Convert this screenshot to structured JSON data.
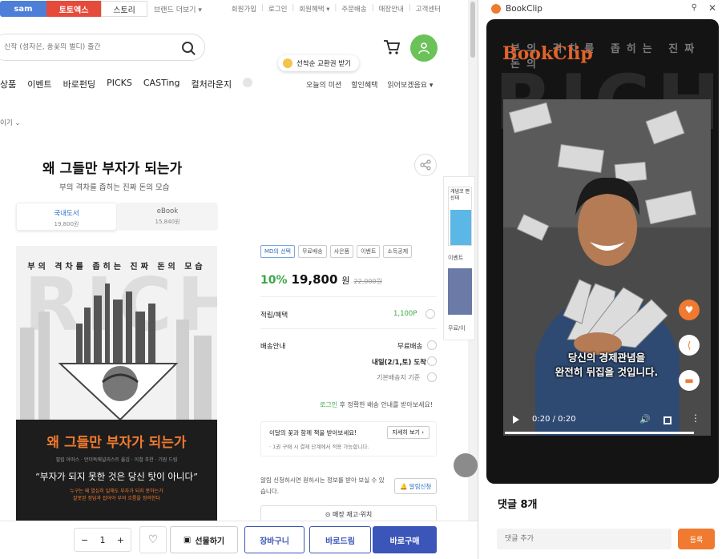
{
  "shop": {
    "top_tabs": [
      "sam",
      "토토엑스",
      "스토리"
    ],
    "brand_more": "브랜드 더보기 ▾",
    "util_links": [
      "회원가입",
      "로그인",
      "회원혜택 ▾",
      "주문배송",
      "매장안내",
      "고객센터"
    ],
    "search": {
      "placeholder": "신작 (성자은, 풍꽃의 벌디) 출간"
    },
    "coin_badge": "선착순 교환권 받기",
    "gnb": [
      "상품",
      "이벤트",
      "바로펀딩",
      "PICKS",
      "CASTing",
      "컬처라운지"
    ],
    "gnb_right": [
      "오늘의 미션",
      "할인혜택",
      "읽어보겠음요 ▾"
    ],
    "breadcrumb": "이기 ⌄",
    "book": {
      "title": "왜 그들만 부자가 되는가",
      "subtitle": "부의 격차를 좁히는 진짜 돈의 모습",
      "format_print": "국내도서",
      "format_print_price": "19,800원",
      "format_ebook": "eBook",
      "format_ebook_price": "15,840원"
    },
    "cover": {
      "top_text": "부의 격차를 좁히는 진짜 돈의 모습",
      "rich": "RICH",
      "title": "왜 그들만 부자가 되는가",
      "small": "필립 아마스 · 언더독애널리스트 옮김 · 이철 추천 · 기원 드림",
      "quote": "“부자가 되지 못한 것은 당신 탓이 아니다”",
      "line1": "누구는 왜 열심히 일해도 부자가 되지 못하는가",
      "line2": "잘못된 정답과 잡아야 부의 흐름을 정의한다"
    },
    "tags": [
      "MD의 선택",
      "무료배송",
      "사은품",
      "이벤트",
      "소득공제"
    ],
    "price": {
      "discount": "10%",
      "now": "19,800",
      "won": "원",
      "original": "22,000원"
    },
    "points_label": "적립/혜택",
    "points_value": "1,100P",
    "delivery_label": "배송안내",
    "delivery_free": "무료배송",
    "delivery_date": "내일(2/1,토) 도착",
    "delivery_base": "기본배송지 기준",
    "login_note_link": "로그인",
    "login_note_rest": " 후 정확한 배송 안내를 받아보세요!",
    "promo_text1": "이달의 꽃과 함께 책을 받아보세요!",
    "promo_text2": "· 1권 구매 시 결제 단계에서 적용 가능합니다.",
    "promo_btn": "자세히 보기 ›",
    "alarm_text": "알림 신청하시면 원하시는 정보를 받아 보실 수 있습니다.",
    "alarm_btn": "🔔 알림신청",
    "stock_btn": "⊙ 매장 재고·위치",
    "rail_thumb_text": "개념코 편 신데",
    "rail_label1": "이벤트",
    "rail_label2": "무료/이",
    "buybar": {
      "qty": "1",
      "minus": "−",
      "plus": "+",
      "gift": "선물하기",
      "cart": "장바구니",
      "drim": "바로드림",
      "buy": "바로구매"
    }
  },
  "bookclip": {
    "window_title": "BookClip",
    "brand": "BookClip",
    "watermark_text": "부의 격차를 좁히는 진짜 돈의",
    "watermark_rich": "RICH",
    "caption_line1": "당신의 경제관념을",
    "caption_line2": "완전히 뒤집을 것입니다.",
    "time": "0:20 / 0:20",
    "progress": 1.0,
    "comments_title": "댓글 8개",
    "comment_placeholder": "댓글 추가",
    "comment_submit": "등록",
    "accent": "#f07a2f"
  }
}
